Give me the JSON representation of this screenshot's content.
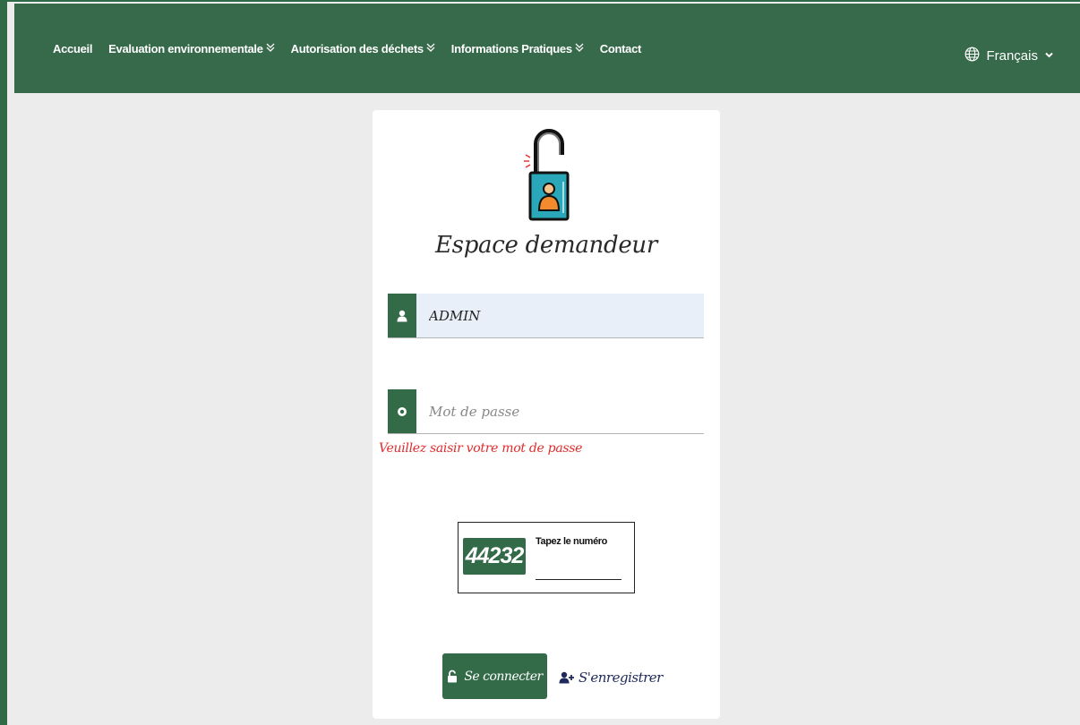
{
  "nav": {
    "items": [
      {
        "label": "Accueil",
        "dropdown": false
      },
      {
        "label": "Evaluation environnementale",
        "dropdown": true
      },
      {
        "label": "Autorisation des déchets",
        "dropdown": true
      },
      {
        "label": "Informations Pratiques",
        "dropdown": true
      },
      {
        "label": "Contact",
        "dropdown": false
      }
    ],
    "language": "Français"
  },
  "login": {
    "title": "Espace demandeur",
    "username_value": "ADMIN",
    "password_placeholder": "Mot de passe",
    "password_error": "Veuillez saisir votre mot de passe",
    "captcha_code": "44232",
    "captcha_label": "Tapez le numéro",
    "login_button": "Se connecter",
    "register_link": "S'enregistrer"
  },
  "colors": {
    "brand_green": "#366a4a",
    "error_red": "#e02b2b",
    "link_blue": "#1f2a5c",
    "input_fill": "#e8eff9"
  },
  "icons": {
    "nav_dropdown": "double-chevron-down-icon",
    "language": "globe-icon",
    "header": "padlock-user-icon",
    "username": "user-icon",
    "password": "key-icon",
    "login_button": "unlock-icon",
    "register": "user-plus-icon"
  }
}
